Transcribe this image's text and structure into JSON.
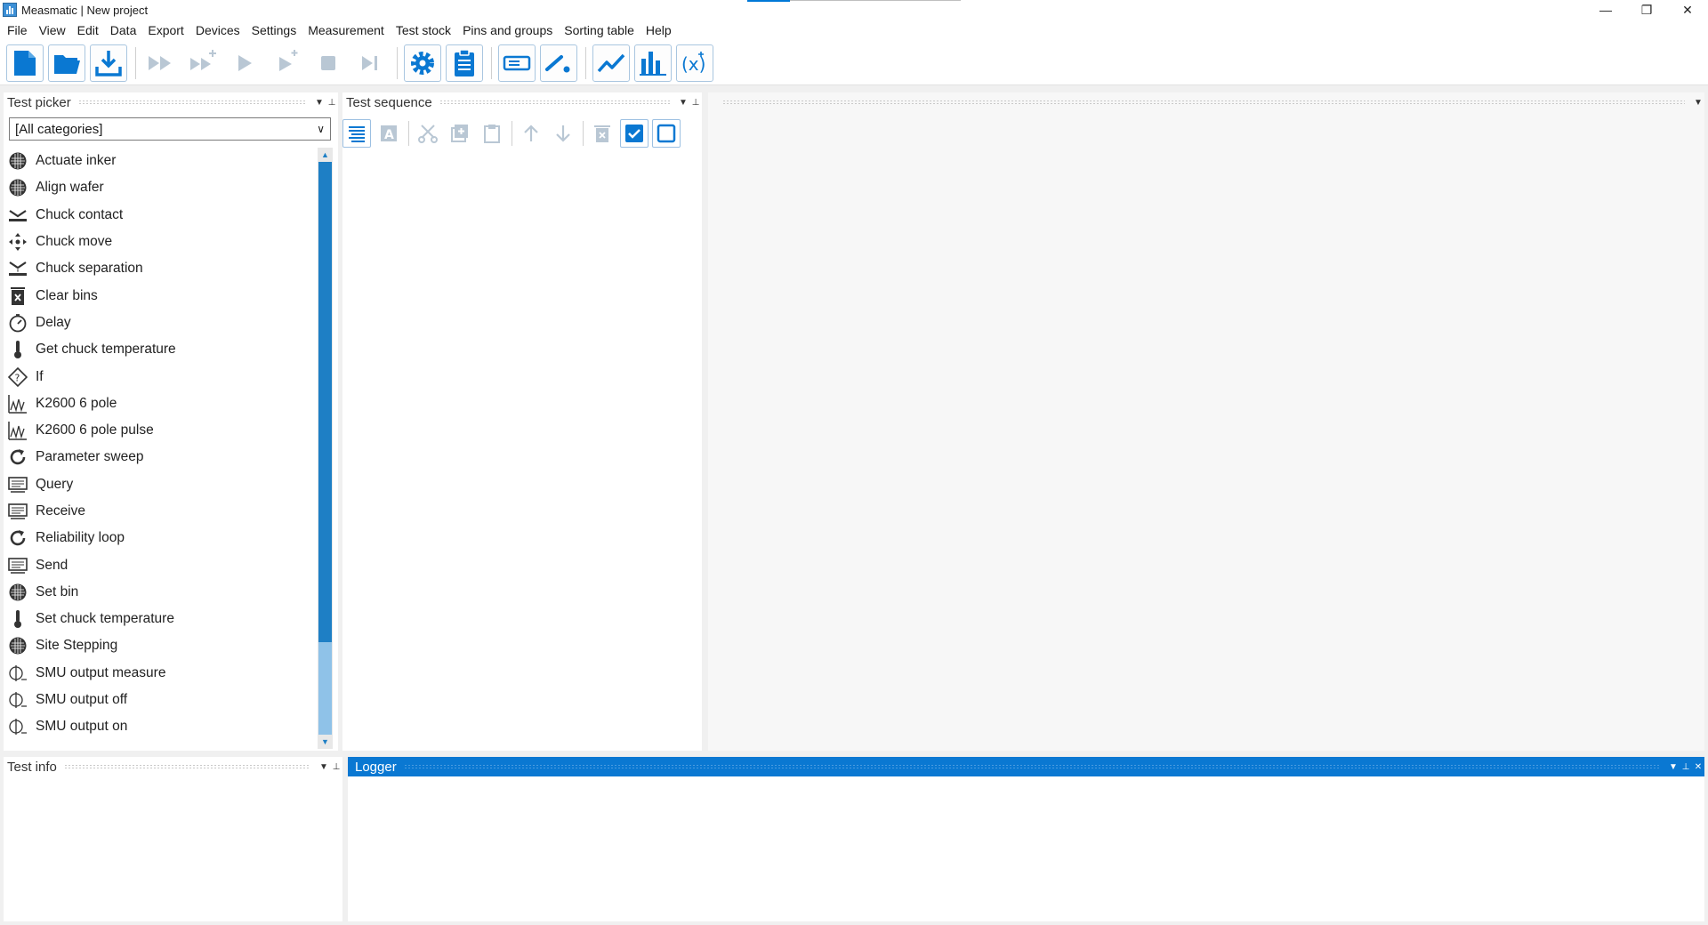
{
  "window": {
    "title": "Measmatic | New project",
    "controls": {
      "minimize": "—",
      "restore": "❐",
      "close": "✕"
    }
  },
  "menu": [
    "File",
    "View",
    "Edit",
    "Data",
    "Export",
    "Devices",
    "Settings",
    "Measurement",
    "Test stock",
    "Pins and groups",
    "Sorting table",
    "Help"
  ],
  "toolbar": {
    "icons": [
      "new-project-icon",
      "open-folder-icon",
      "save-download-icon",
      "run-all-icon",
      "run-all-plus-icon",
      "play-icon",
      "play-step-icon",
      "stop-icon",
      "skip-to-end-icon",
      "gear-icon",
      "clipboard-icon",
      "device-icon",
      "probe-icon",
      "line-chart-icon",
      "bar-chart-icon",
      "formula-icon"
    ],
    "accent_color": "#0a78d2",
    "disabled_color": "#b9c7d4"
  },
  "test_picker": {
    "title": "Test picker",
    "category": "[All categories]",
    "items": [
      {
        "label": "Actuate inker",
        "icon": "wafer-icon"
      },
      {
        "label": "Align wafer",
        "icon": "wafer-icon"
      },
      {
        "label": "Chuck contact",
        "icon": "chuck-contact-icon"
      },
      {
        "label": "Chuck move",
        "icon": "move-arrows-icon"
      },
      {
        "label": "Chuck separation",
        "icon": "chuck-separation-icon"
      },
      {
        "label": "Clear bins",
        "icon": "clear-bins-icon"
      },
      {
        "label": "Delay",
        "icon": "stopwatch-icon"
      },
      {
        "label": "Get chuck temperature",
        "icon": "thermometer-icon"
      },
      {
        "label": "If",
        "icon": "if-diamond-icon"
      },
      {
        "label": "K2600 6 pole",
        "icon": "instrument-icon"
      },
      {
        "label": "K2600 6 pole pulse",
        "icon": "instrument-icon"
      },
      {
        "label": "Parameter sweep",
        "icon": "loop-icon"
      },
      {
        "label": "Query",
        "icon": "terminal-icon"
      },
      {
        "label": "Receive",
        "icon": "terminal-icon"
      },
      {
        "label": "Reliability loop",
        "icon": "loop-icon"
      },
      {
        "label": "Send",
        "icon": "terminal-icon"
      },
      {
        "label": "Set bin",
        "icon": "wafer-icon"
      },
      {
        "label": "Set chuck temperature",
        "icon": "thermometer-icon"
      },
      {
        "label": "Site Stepping",
        "icon": "wafer-icon"
      },
      {
        "label": "SMU output measure",
        "icon": "smu-icon"
      },
      {
        "label": "SMU output off",
        "icon": "smu-icon"
      },
      {
        "label": "SMU output on",
        "icon": "smu-icon"
      }
    ]
  },
  "test_sequence": {
    "title": "Test sequence",
    "tools": [
      "list-icon",
      "rename-icon",
      "cut-icon",
      "duplicate-icon",
      "paste-icon",
      "move-up-icon",
      "move-down-icon",
      "delete-icon",
      "check-all-icon",
      "uncheck-all-icon"
    ]
  },
  "test_info": {
    "title": "Test info"
  },
  "logger": {
    "title": "Logger"
  },
  "header_buttons": {
    "dropdown": "▼",
    "pin": "📌",
    "close": "✕"
  }
}
